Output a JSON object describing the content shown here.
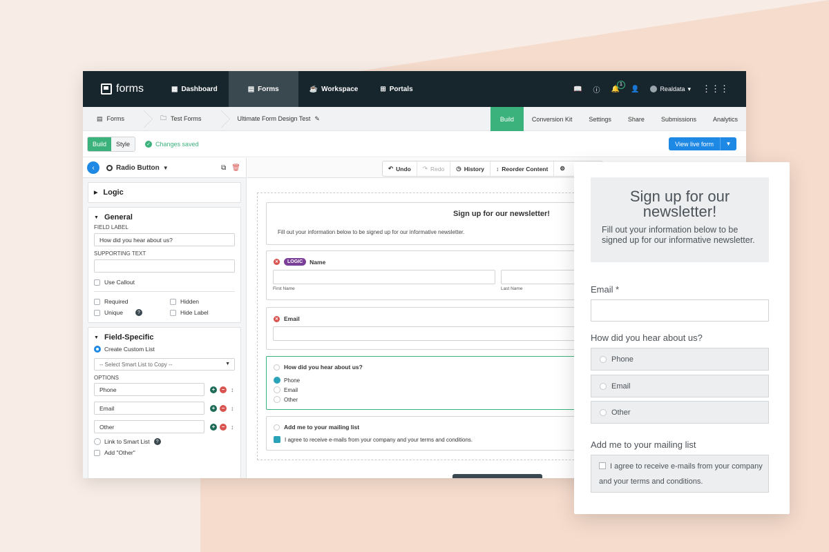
{
  "colors": {
    "accent_green": "#3bb27b",
    "accent_blue": "#1e88e5",
    "nav_dark": "#17252d",
    "logic_purple": "#7b3f98"
  },
  "topnav": {
    "logo": "forms",
    "items": [
      {
        "label": "Dashboard",
        "icon": "dashboard-icon"
      },
      {
        "label": "Forms",
        "icon": "forms-icon"
      },
      {
        "label": "Workspace",
        "icon": "workspace-icon"
      },
      {
        "label": "Portals",
        "icon": "portals-icon"
      }
    ],
    "notification_count": "1",
    "user": "Realdata"
  },
  "breadcrumb": {
    "items": [
      "Forms",
      "Test Forms",
      "Ultimate Form Design Test"
    ]
  },
  "subtabs": [
    "Build",
    "Conversion Kit",
    "Settings",
    "Share",
    "Submissions",
    "Analytics"
  ],
  "toolbar": {
    "build": "Build",
    "style": "Style",
    "status": "Changes saved",
    "live_button": "View live form"
  },
  "left_panel": {
    "field_type": "Radio Button",
    "logic_title": "Logic",
    "general_title": "General",
    "field_label_lbl": "FIELD LABEL",
    "field_label_value": "How did you hear about us?",
    "supporting_text_lbl": "SUPPORTING TEXT",
    "use_callout": "Use Callout",
    "required": "Required",
    "hidden": "Hidden",
    "unique": "Unique",
    "hide_label": "Hide Label",
    "field_specific_title": "Field-Specific",
    "create_custom_list": "Create Custom List",
    "smart_list_placeholder": "-- Select Smart List to Copy --",
    "options_lbl": "OPTIONS",
    "options": [
      "Phone",
      "Email",
      "Other"
    ],
    "link_smart_list": "Link to Smart List",
    "add_other": "Add \"Other\""
  },
  "center": {
    "actions": [
      "Undo",
      "Redo",
      "History",
      "Reorder Content"
    ],
    "form_title": "Sign up for our newsletter!",
    "form_desc": "Fill out your information below to be signed up for our informative newsletter.",
    "logic_tag": "LOGIC",
    "name_label": "Name",
    "first_name": "First Name",
    "last_name": "Last Name",
    "email_label": "Email",
    "hear_label": "How did you hear about us?",
    "hear_options": [
      "Phone",
      "Email",
      "Other"
    ],
    "mailing_label": "Add me to your mailing list",
    "mailing_text": "I agree to receive e-mails from your company and your terms and conditions."
  },
  "preview": {
    "title": "Sign up for our newsletter!",
    "desc": "Fill out your information below to be signed up for our informative newsletter.",
    "email_label": "Email *",
    "hear_label": "How did you hear about us?",
    "options": [
      "Phone",
      "Email",
      "Other"
    ],
    "mailing_label": "Add me to your mailing list",
    "agree_line1": "I agree to receive e-mails from your company",
    "agree_line2": "and your terms and conditions."
  }
}
